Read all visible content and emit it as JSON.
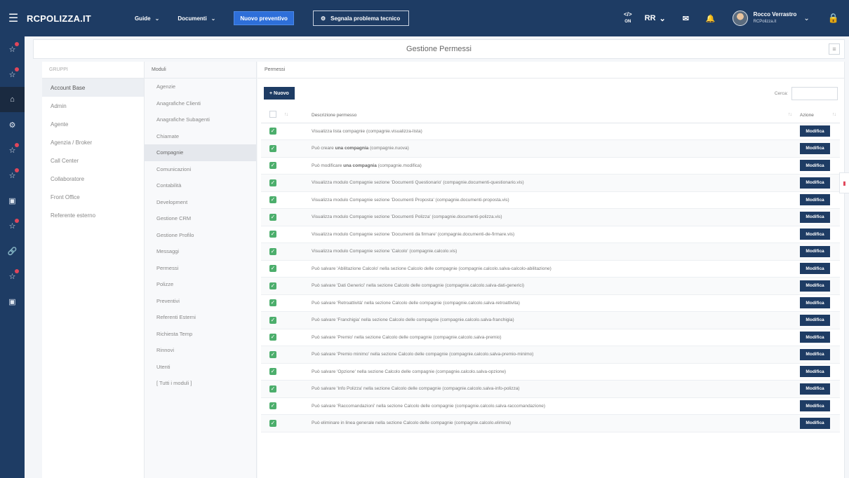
{
  "topbar": {
    "brand": "RCPOLIZZA.IT",
    "nav": [
      {
        "label": "Guide"
      },
      {
        "label": "Documenti"
      }
    ],
    "new_quote": "Nuovo preventivo",
    "report_problem": "Segnala problema tecnico",
    "code_toggle": {
      "symbol": "</>",
      "state": "ON"
    },
    "lang": "RR",
    "user": {
      "name": "Rocco Verrastro",
      "company": "RCPolizza.it"
    }
  },
  "rail": [
    {
      "icon": "badge-icon",
      "active": false
    },
    {
      "icon": "badge-icon",
      "active": false
    },
    {
      "icon": "home-icon",
      "active": true
    },
    {
      "icon": "settings-icon",
      "active": false
    },
    {
      "icon": "badge-icon",
      "active": false
    },
    {
      "icon": "badge-icon",
      "active": false
    },
    {
      "icon": "window-icon",
      "active": false
    },
    {
      "icon": "badge-icon",
      "active": false
    },
    {
      "icon": "link-icon",
      "active": false
    },
    {
      "icon": "badge-icon",
      "active": false
    },
    {
      "icon": "window-icon",
      "active": false
    }
  ],
  "page": {
    "title": "Gestione Permessi"
  },
  "groups": {
    "header": "GRUPPI",
    "items": [
      "Account Base",
      "Admin",
      "Agente",
      "Agenzia / Broker",
      "Call Center",
      "Collaboratore",
      "Front Office",
      "Referente esterno"
    ],
    "active_index": 0
  },
  "modules": {
    "header": "Moduli",
    "items": [
      "Agenzie",
      "Anagrafiche Clienti",
      "Anagrafiche Subagenti",
      "Chiamate",
      "Compagnie",
      "Comunicazioni",
      "Contabilità",
      "Development",
      "Gestione CRM",
      "Gestione Profilo",
      "Messaggi",
      "Permessi",
      "Polizze",
      "Preventivi",
      "Referenti Esterni",
      "Richiesta Temp",
      "Rinnovi",
      "Utenti",
      "[ Tutti i moduli ]"
    ],
    "active_index": 4
  },
  "permissions": {
    "header": "Permessi",
    "new_label": "+ Nuovo",
    "search_label": "Cerca:",
    "search_value": "",
    "columns": {
      "description": "Descrizione permesso",
      "action": "Azione"
    },
    "edit_label": "Modifica",
    "rows": [
      {
        "pre": "Visualizza lista compagnie",
        "code": "(compagnie.visualizza-lista)"
      },
      {
        "pre": "Può creare ",
        "bold": "una compagnia",
        "code": "(compagnie.nuova)"
      },
      {
        "pre": "Può modificare ",
        "bold": "una compagnia",
        "code": "(compagnie.modifica)"
      },
      {
        "pre": "Visualizza modulo Compagnie sezione 'Documenti Questionario'",
        "code": "(compagnie.documenti-questionario.vis)"
      },
      {
        "pre": "Visualizza modulo Compagnie sezione 'Documenti Proposta'",
        "code": "(compagnie.documenti-proposta.vis)"
      },
      {
        "pre": "Visualizza modulo Compagnie sezione 'Documenti Polizza'",
        "code": "(compagnie.documenti-polizza.vis)"
      },
      {
        "pre": "Visualizza modulo Compagnie sezione 'Documenti da firmare'",
        "code": "(compagnie.documenti-de-firmare.vis)"
      },
      {
        "pre": "Visualizza modulo Compagnie sezione 'Calcolo'",
        "code": "(compagnie.calcolo.vis)"
      },
      {
        "pre": "Può salvare 'Abilitazione Calcolo' nella sezione Calcolo delle compagnie",
        "code": "(compagnie.calcolo.salva-calcolo-abilitazione)"
      },
      {
        "pre": "Può salvare 'Dati Generici' nella sezione Calcolo delle compagnie",
        "code": "(compagnie.calcolo.salva-dati-generici)"
      },
      {
        "pre": "Può salvare 'Retroattività' nella sezione Calcolo delle compagnie",
        "code": "(compagnie.calcolo.salva-retroattivita)"
      },
      {
        "pre": "Può salvare 'Franchigia' nella sezione Calcolo delle compagnie",
        "code": "(compagnie.calcolo.salva-franchigia)"
      },
      {
        "pre": "Può salvare 'Premio' nella sezione Calcolo delle compagnie",
        "code": "(compagnie.calcolo.salva-premio)"
      },
      {
        "pre": "Può salvare 'Premio minimo' nella sezione Calcolo delle compagnie",
        "code": "(compagnie.calcolo.salva-premio-minimo)"
      },
      {
        "pre": "Può salvare 'Opzione' nella sezione Calcolo delle compagnie",
        "code": "(compagnie.calcolo.salva-opzione)"
      },
      {
        "pre": "Può salvare 'Info Polizza' nella sezione Calcolo delle compagnie",
        "code": "(compagnie.calcolo.salva-info-polizza)"
      },
      {
        "pre": "Può salvare 'Raccomandazioni' nella sezione Calcolo delle compagnie",
        "code": "(compagnie.calcolo.salva-raccomandazione)"
      },
      {
        "pre": "Può eliminare in linea generale nella sezione Calcolo delle compagnie",
        "code": "(compagnie.calcolo.elimina)"
      }
    ]
  },
  "colors": {
    "navy": "#1e3c64",
    "accent_blue": "#2e6fd9",
    "check_green": "#4cae6c",
    "notify_red": "#e0465a"
  }
}
